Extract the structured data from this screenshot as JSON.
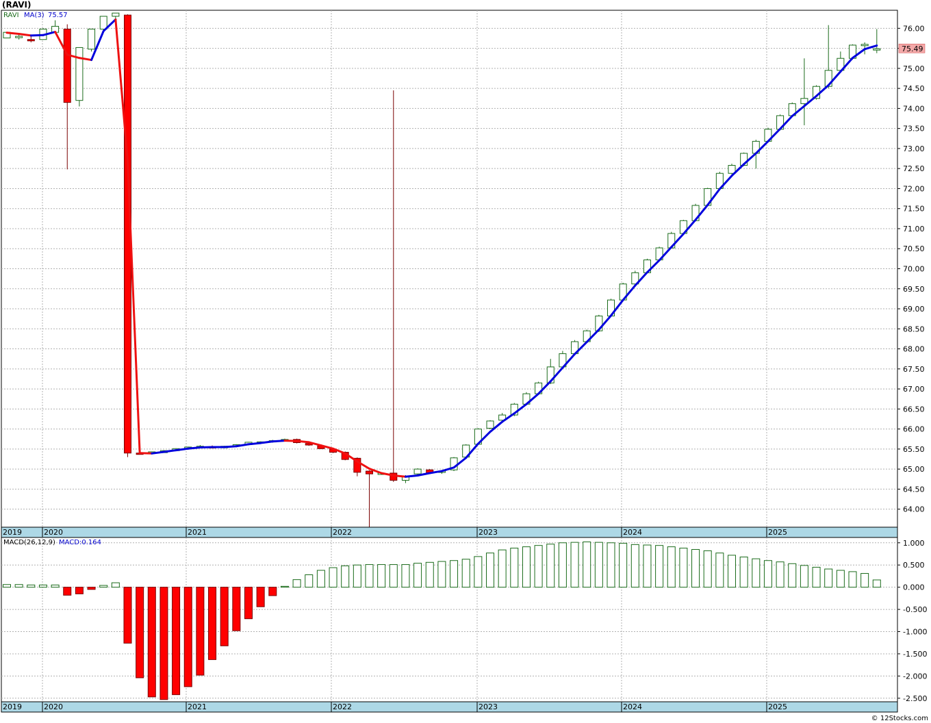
{
  "header": {
    "title": "(RAVI)",
    "legend_symbol": "RAVI",
    "legend_ma_label": "MA(3)",
    "legend_ma_value": "75.57",
    "last_price": "75.49"
  },
  "macd_panel": {
    "label": "MACD(26,12,9)",
    "value_label": "MACD:0.164"
  },
  "footer": {
    "credit": "© 12Stocks.com"
  },
  "colors": {
    "up": "#1a6b1a",
    "down": "#ff0000",
    "ma_up": "#0000dd",
    "ma_down": "#ee1111",
    "grid": "#b0b0b0",
    "axis_band": "#add8e6",
    "price_badge": "#f4a8a8"
  },
  "chart_data": [
    {
      "type": "candlestick",
      "title": "(RAVI)",
      "ylim": [
        63.55,
        76.45
      ],
      "y_ticks": [
        "64.00",
        "64.50",
        "65.00",
        "65.50",
        "66.00",
        "66.50",
        "67.00",
        "67.50",
        "68.00",
        "68.50",
        "69.00",
        "69.50",
        "70.00",
        "70.50",
        "71.00",
        "71.50",
        "72.00",
        "72.50",
        "73.00",
        "73.50",
        "74.00",
        "74.50",
        "75.00",
        "75.50",
        "76.00"
      ],
      "x_tick_labels": [
        "2019",
        "2020",
        "2021",
        "2022",
        "2023",
        "2024",
        "2025"
      ],
      "grid": true,
      "series": [
        {
          "name": "RAVI",
          "ohlc": [
            [
              75.76,
              75.9,
              75.76,
              75.9
            ],
            [
              75.78,
              75.85,
              75.72,
              75.8
            ],
            [
              75.72,
              75.8,
              75.65,
              75.7
            ],
            [
              75.72,
              76.0,
              75.72,
              75.98
            ],
            [
              75.9,
              76.2,
              75.88,
              76.05
            ],
            [
              75.98,
              76.1,
              72.48,
              74.15
            ],
            [
              74.2,
              75.5,
              74.05,
              75.52
            ],
            [
              75.48,
              75.9,
              75.42,
              75.98
            ],
            [
              75.98,
              76.3,
              75.96,
              76.3
            ],
            [
              76.3,
              76.38,
              76.18,
              76.38
            ],
            [
              76.33,
              76.35,
              65.3,
              65.4
            ],
            [
              65.4,
              65.43,
              65.37,
              65.38
            ],
            [
              65.39,
              65.44,
              65.39,
              65.43
            ],
            [
              65.41,
              65.47,
              65.41,
              65.46
            ],
            [
              65.46,
              65.52,
              65.45,
              65.51
            ],
            [
              65.51,
              65.56,
              65.5,
              65.55
            ],
            [
              65.56,
              65.6,
              65.53,
              65.57
            ],
            [
              65.56,
              65.59,
              65.52,
              65.53
            ],
            [
              65.53,
              65.58,
              65.52,
              65.57
            ],
            [
              65.57,
              65.62,
              65.56,
              65.61
            ],
            [
              65.61,
              65.68,
              65.6,
              65.67
            ],
            [
              65.67,
              65.69,
              65.65,
              65.68
            ],
            [
              65.68,
              65.73,
              65.66,
              65.71
            ],
            [
              65.73,
              65.76,
              65.7,
              65.74
            ],
            [
              65.74,
              65.76,
              65.64,
              65.66
            ],
            [
              65.64,
              65.67,
              65.58,
              65.6
            ],
            [
              65.58,
              65.6,
              65.5,
              65.51
            ],
            [
              65.5,
              65.52,
              65.4,
              65.42
            ],
            [
              65.42,
              65.44,
              65.22,
              65.24
            ],
            [
              65.27,
              65.29,
              64.82,
              64.92
            ],
            [
              64.95,
              64.97,
              63.55,
              64.88
            ],
            [
              64.88,
              64.92,
              64.86,
              64.9
            ],
            [
              64.9,
              74.45,
              64.68,
              64.72
            ],
            [
              64.72,
              64.85,
              64.65,
              64.82
            ],
            [
              64.88,
              65.02,
              64.86,
              65.0
            ],
            [
              64.98,
              65.0,
              64.88,
              64.9
            ],
            [
              64.92,
              64.97,
              64.88,
              64.95
            ],
            [
              64.98,
              65.3,
              64.95,
              65.28
            ],
            [
              65.3,
              65.62,
              65.28,
              65.6
            ],
            [
              65.62,
              66.02,
              65.6,
              66.0
            ],
            [
              66.02,
              66.22,
              66.0,
              66.2
            ],
            [
              66.22,
              66.4,
              66.18,
              66.35
            ],
            [
              66.35,
              66.65,
              66.32,
              66.62
            ],
            [
              66.62,
              66.92,
              66.6,
              66.88
            ],
            [
              66.88,
              67.18,
              66.86,
              67.15
            ],
            [
              67.15,
              67.75,
              67.12,
              67.55
            ],
            [
              67.55,
              67.95,
              67.52,
              67.88
            ],
            [
              67.88,
              68.22,
              67.85,
              68.18
            ],
            [
              68.18,
              68.48,
              68.15,
              68.45
            ],
            [
              68.45,
              68.85,
              68.42,
              68.82
            ],
            [
              68.82,
              69.25,
              68.8,
              69.22
            ],
            [
              69.22,
              69.65,
              69.2,
              69.62
            ],
            [
              69.62,
              69.95,
              69.6,
              69.9
            ],
            [
              69.9,
              70.25,
              69.88,
              70.22
            ],
            [
              70.22,
              70.55,
              70.2,
              70.52
            ],
            [
              70.52,
              70.92,
              70.5,
              70.88
            ],
            [
              70.88,
              71.22,
              70.86,
              71.2
            ],
            [
              71.2,
              71.62,
              71.18,
              71.58
            ],
            [
              71.58,
              72.02,
              71.56,
              72.0
            ],
            [
              72.0,
              72.42,
              71.98,
              72.38
            ],
            [
              72.38,
              72.62,
              72.36,
              72.58
            ],
            [
              72.58,
              72.9,
              72.56,
              72.88
            ],
            [
              72.88,
              73.22,
              72.5,
              73.18
            ],
            [
              73.18,
              73.52,
              73.15,
              73.48
            ],
            [
              73.48,
              73.85,
              73.45,
              73.82
            ],
            [
              73.82,
              74.15,
              73.8,
              74.12
            ],
            [
              74.12,
              75.25,
              73.58,
              74.25
            ],
            [
              74.25,
              74.58,
              74.22,
              74.55
            ],
            [
              74.55,
              76.08,
              74.5,
              74.95
            ],
            [
              74.95,
              75.42,
              74.92,
              75.25
            ],
            [
              75.25,
              75.6,
              75.22,
              75.58
            ],
            [
              75.58,
              75.65,
              75.35,
              75.6
            ],
            [
              75.46,
              75.98,
              75.38,
              75.49
            ]
          ]
        },
        {
          "name": "MA(3)",
          "values": [
            75.89,
            75.86,
            75.82,
            75.83,
            75.91,
            75.34,
            75.26,
            75.21,
            75.93,
            76.22,
            72.68,
            65.4,
            65.39,
            65.43,
            65.47,
            65.51,
            65.54,
            65.55,
            65.55,
            65.57,
            65.62,
            65.65,
            65.69,
            65.71,
            65.7,
            65.67,
            65.59,
            65.51,
            65.39,
            65.19,
            65.01,
            64.9,
            64.84,
            64.81,
            64.84,
            64.9,
            64.95,
            65.04,
            65.28,
            65.63,
            65.93,
            66.18,
            66.39,
            66.62,
            66.88,
            67.19,
            67.53,
            67.87,
            68.17,
            68.48,
            68.83,
            69.22,
            69.58,
            69.91,
            70.21,
            70.54,
            70.87,
            71.22,
            71.59,
            71.99,
            72.32,
            72.61,
            72.88,
            73.18,
            73.49,
            73.81,
            74.06,
            74.31,
            74.58,
            74.92,
            75.26,
            75.48,
            75.57
          ]
        }
      ]
    },
    {
      "type": "bar",
      "title": "MACD(26,12,9)",
      "ylim": [
        -2.58,
        1.12
      ],
      "y_ticks": [
        "1.000",
        "0.500",
        "0.000",
        "-0.500",
        "-1.000",
        "-1.500",
        "-2.000",
        "-2.500"
      ],
      "x_tick_labels": [
        "2019",
        "2020",
        "2021",
        "2022",
        "2023",
        "2024",
        "2025"
      ],
      "series": [
        {
          "name": "MACD",
          "values": [
            0.06,
            0.06,
            0.05,
            0.05,
            0.05,
            -0.18,
            -0.15,
            -0.05,
            0.04,
            0.1,
            -1.26,
            -2.04,
            -2.47,
            -2.53,
            -2.42,
            -2.24,
            -1.98,
            -1.63,
            -1.32,
            -0.98,
            -0.71,
            -0.44,
            -0.19,
            0.02,
            0.17,
            0.28,
            0.38,
            0.44,
            0.48,
            0.5,
            0.51,
            0.51,
            0.51,
            0.51,
            0.54,
            0.56,
            0.58,
            0.6,
            0.63,
            0.69,
            0.77,
            0.84,
            0.88,
            0.91,
            0.94,
            0.97,
            1.0,
            1.01,
            1.02,
            1.01,
            1.0,
            0.99,
            0.96,
            0.95,
            0.94,
            0.91,
            0.88,
            0.85,
            0.82,
            0.77,
            0.72,
            0.68,
            0.64,
            0.6,
            0.57,
            0.53,
            0.49,
            0.45,
            0.41,
            0.38,
            0.35,
            0.31,
            0.164
          ]
        }
      ]
    }
  ]
}
